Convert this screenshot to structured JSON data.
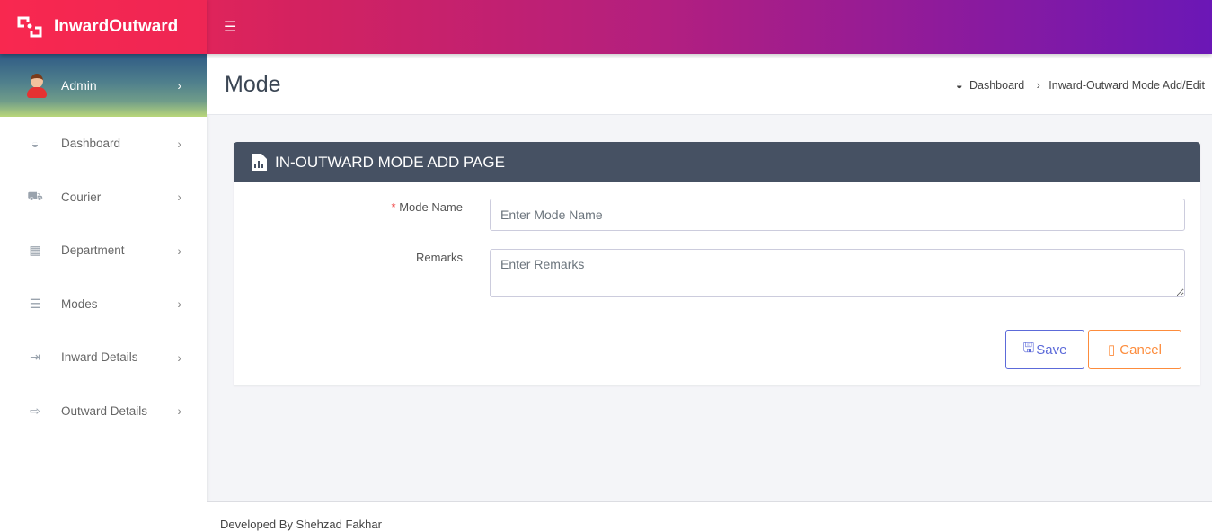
{
  "app": {
    "title": "InwardOutward"
  },
  "user": {
    "name": "Admin"
  },
  "sidebar": {
    "items": [
      {
        "label": "Dashboard",
        "icon": "tachometer-icon"
      },
      {
        "label": "Courier",
        "icon": "truck-icon"
      },
      {
        "label": "Department",
        "icon": "building-icon"
      },
      {
        "label": "Modes",
        "icon": "server-icon"
      },
      {
        "label": "Inward Details",
        "icon": "sign-in-icon"
      },
      {
        "label": "Outward Details",
        "icon": "sign-out-icon"
      }
    ]
  },
  "header": {
    "title": "Mode",
    "breadcrumb": [
      "Dashboard",
      "Inward-Outward Mode Add/Edit"
    ]
  },
  "card": {
    "title": "IN-OUTWARD MODE ADD PAGE",
    "mode_name": {
      "label": "Mode Name",
      "required": "*",
      "placeholder": "Enter Mode Name",
      "value": ""
    },
    "remarks": {
      "label": "Remarks",
      "placeholder": "Enter Remarks",
      "value": ""
    },
    "save_label": "Save",
    "cancel_label": "Cancel"
  },
  "colors": {
    "save": "#5c6ad9",
    "cancel": "#fd8c3c",
    "card_header": "#465163"
  },
  "footer": {
    "text": "Developed By Shehzad Fakhar"
  }
}
